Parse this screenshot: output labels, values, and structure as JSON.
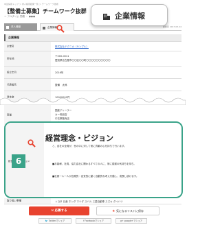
{
  "breadcrumb": "中途採用トップ ＞ 求人検索結果一覧 ＞ チームワーク技術",
  "title": "【整備士募集】チームワーク抜群",
  "meta": "ー フルタイム 勤務 ・ ●●●",
  "tabs": [
    {
      "label": "求人情報"
    },
    {
      "label": "企業情報"
    }
  ],
  "update_date": "更新日 2017.03.24",
  "zoom_callout": "企業情報",
  "section_title": "企業情報",
  "rows": [
    {
      "label": "企業名",
      "value": "株式会社テクニカ（サンプル）"
    },
    {
      "label": "所在地",
      "value_line1": "〒000-0011",
      "value_line2": "愛知県名古屋市〇〇区〇〇町〇〇〇〇〇〇〇〇〇〇"
    },
    {
      "label": "設立年月",
      "value": "2016年"
    },
    {
      "label": "代表者名",
      "value": "整備　太郎"
    },
    {
      "label": "資本金",
      "value": "10000000円"
    },
    {
      "label": "事業",
      "values": [
        "国産ディーラー",
        "カー用品店",
        "中古車販売店",
        "自動車整備"
      ]
    }
  ],
  "vision": {
    "label": "経営理念・ビジョン",
    "callout_title": "経営理念・ビジョン",
    "badge_number": "6",
    "lines": [
      "と、自社の全員が、世の中に対して常に貢献の心を持ちで行います。",
      "■お客様、社員、協力会社に関わるすべての人に、常に感謝の気持ちを持ち。",
      "■社員一人一人が自発的・自覚的に動く自動的な考え行動し、成長し続けます。"
    ]
  },
  "cars_row": {
    "label": "取り扱い車種",
    "value": "トヨタ 日産 ホンダ マツダ スバル 三菱自動車 スズキ ダイハツ"
  },
  "buttons": {
    "apply": "応募する",
    "save": "気になるリストに保存"
  },
  "share": [
    {
      "label": "Twitterでシェア"
    },
    {
      "label": "Facebookでシェア"
    },
    {
      "label": "google+でシェア"
    }
  ],
  "colors": {
    "accent_green": "#3aa389",
    "apply_red": "#e8432f",
    "link_blue": "#2a64c8"
  }
}
